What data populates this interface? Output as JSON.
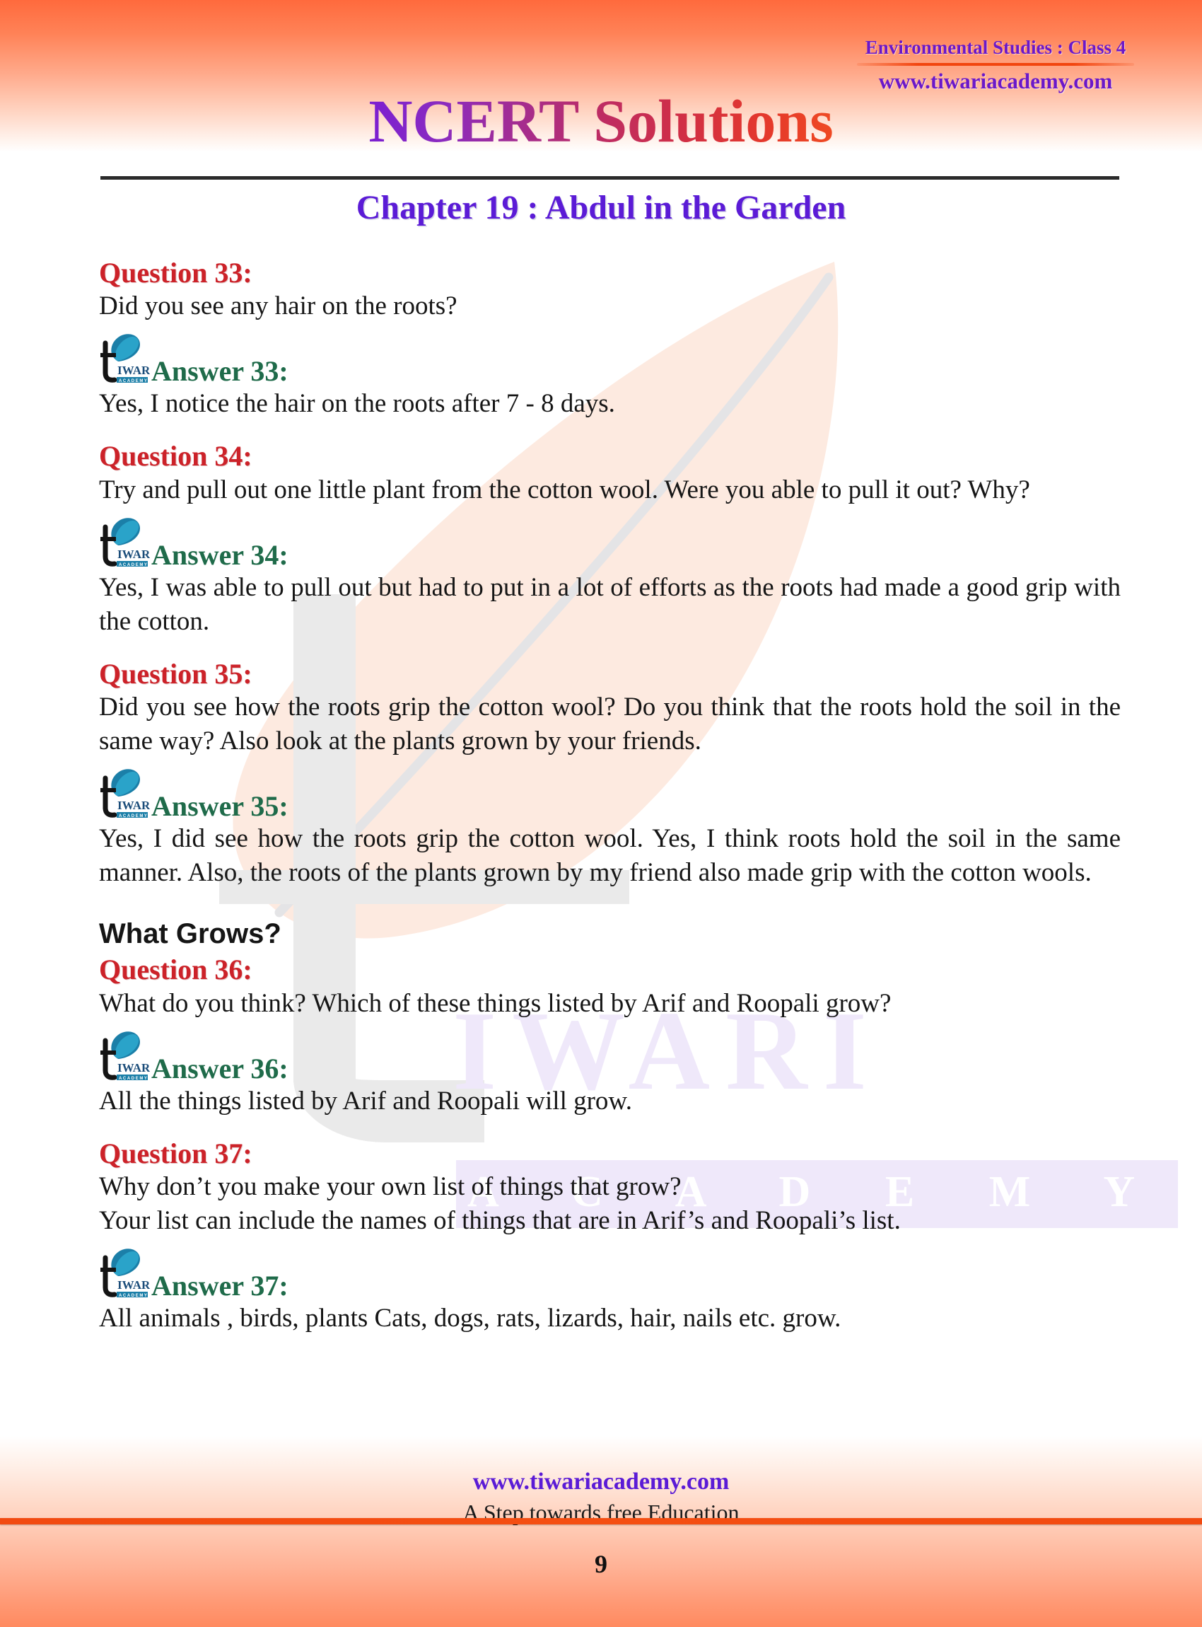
{
  "header": {
    "subject": "Environmental Studies : Class 4",
    "website": "www.tiwariacademy.com",
    "title": "NCERT Solutions",
    "chapter": "Chapter 19 : Abdul in the Garden"
  },
  "logo": {
    "mark_letter": "t",
    "mark_word": "IWARI",
    "mark_sub": "ACADEMY"
  },
  "watermark": {
    "brand": "IWARI",
    "sub": "A C A D E M Y"
  },
  "content": {
    "q33_head": "Question 33:",
    "q33_text": "Did you see any hair on the roots?",
    "a33_head": "Answer 33:",
    "a33_text": "Yes, I notice the hair on the roots after 7 - 8 days.",
    "q34_head": "Question 34:",
    "q34_text": "Try and pull out one little plant from the cotton wool. Were you able to pull it out? Why?",
    "a34_head": "Answer 34:",
    "a34_text": "Yes, I was able to pull out but had to put in a lot of efforts as the roots had made a good grip with the cotton.",
    "q35_head": "Question 35:",
    "q35_text": "Did you see how the roots grip the cotton wool? Do you think that the roots hold the soil in the same way? Also look at the plants grown by your friends.",
    "a35_head": "Answer 35:",
    "a35_text": "Yes, I did see how the roots grip the cotton wool. Yes, I think roots hold the soil in the same manner. Also, the roots of the plants grown by my friend also made grip with the cotton wools.",
    "section_head": "What Grows?",
    "q36_head": "Question 36:",
    "q36_text": "What do you think? Which of these things listed by Arif and Roopali grow?",
    "a36_head": "Answer 36:",
    "a36_text": "All the things listed by Arif and Roopali will grow.",
    "q37_head": "Question 37:",
    "q37_text_line1": "Why don’t you make your own list of things that grow?",
    "q37_text_line2": "Your list can include the names of things that are in Arif’s and Roopali’s list.",
    "a37_head": "Answer 37:",
    "a37_text": "All animals , birds, plants Cats, dogs, rats, lizards, hair, nails etc. grow."
  },
  "footer": {
    "url": "www.tiwariacademy.com",
    "tagline": "A Step towards free Education",
    "page_number": "9"
  },
  "colors": {
    "question": "#CC2229",
    "answer": "#1F6B4A",
    "brand_purple": "#5B1BD6",
    "accent_orange": "#F2450F",
    "body": "#161616"
  }
}
